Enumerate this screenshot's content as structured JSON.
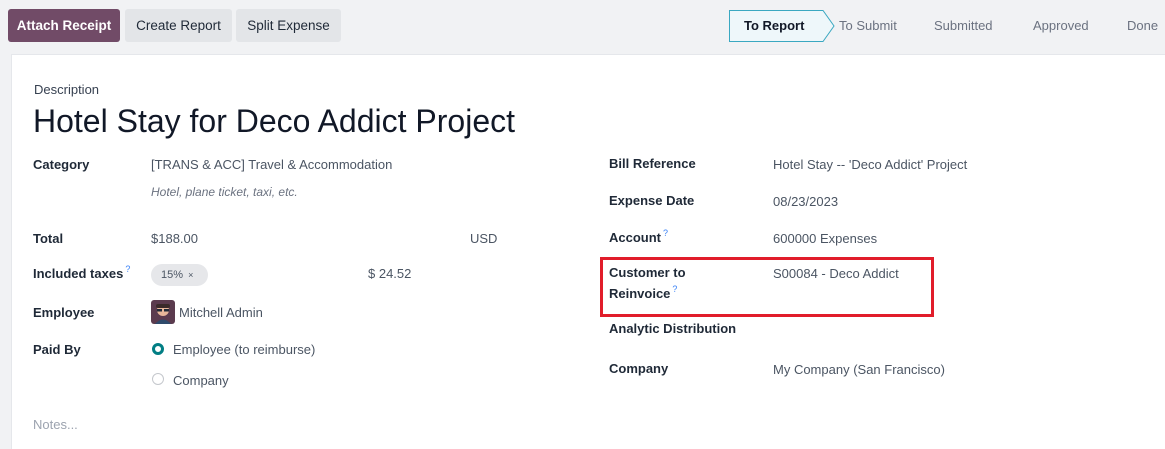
{
  "toolbar": {
    "attach_receipt": "Attach Receipt",
    "create_report": "Create Report",
    "split_expense": "Split Expense"
  },
  "statusbar": {
    "stages": [
      "To Report",
      "To Submit",
      "Submitted",
      "Approved",
      "Done"
    ],
    "active": "To Report"
  },
  "form": {
    "description_label": "Description",
    "title": "Hotel Stay for Deco Addict Project",
    "category": {
      "label": "Category",
      "value": "[TRANS & ACC] Travel & Accommodation",
      "hint": "Hotel, plane ticket, taxi, etc."
    },
    "total": {
      "label": "Total",
      "value": "$188.00",
      "currency": "USD"
    },
    "included_taxes": {
      "label": "Included taxes",
      "tag": "15%",
      "tag_close": "×",
      "amount": "$ 24.52"
    },
    "employee": {
      "label": "Employee",
      "value": "Mitchell Admin"
    },
    "paid_by": {
      "label": "Paid By",
      "options": [
        "Employee (to reimburse)",
        "Company"
      ],
      "selected": "Employee (to reimburse)"
    },
    "bill_reference": {
      "label": "Bill Reference",
      "value": "Hotel Stay -- 'Deco Addict' Project"
    },
    "expense_date": {
      "label": "Expense Date",
      "value": "08/23/2023"
    },
    "account": {
      "label": "Account",
      "value": "600000 Expenses"
    },
    "customer_to_reinvoice": {
      "label_line1": "Customer to",
      "label_line2": "Reinvoice",
      "value": "S00084 - Deco Addict"
    },
    "analytic_distribution": {
      "label": "Analytic Distribution"
    },
    "company": {
      "label": "Company",
      "value": "My Company (San Francisco)"
    },
    "notes_placeholder": "Notes..."
  },
  "help_marker": "?",
  "colors": {
    "primary": "#714b67",
    "highlight": "#e11d2a",
    "radio": "#017e84",
    "stage_border": "#3aa8c1"
  }
}
